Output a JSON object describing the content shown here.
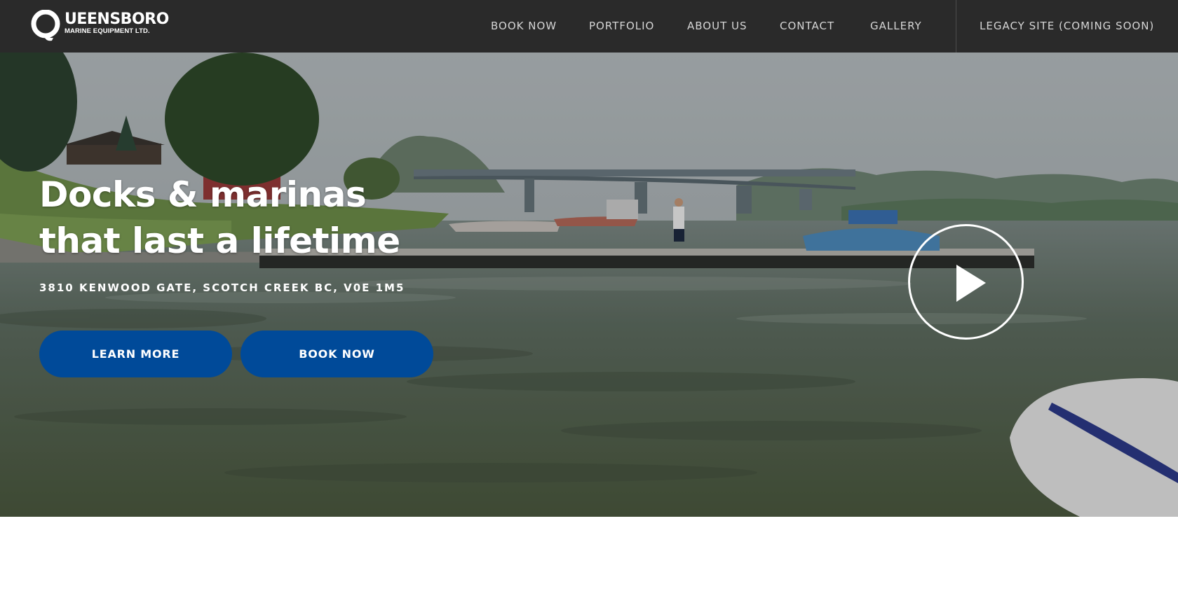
{
  "header": {
    "logo": {
      "title": "UEENSBORO",
      "subtitle": "MARINE EQUIPMENT LTD."
    },
    "nav": [
      {
        "label": "BOOK NOW"
      },
      {
        "label": "PORTFOLIO"
      },
      {
        "label": "ABOUT US"
      },
      {
        "label": "CONTACT"
      },
      {
        "label": "GALLERY"
      },
      {
        "label": "LEGACY SITE (COMING SOON)"
      }
    ]
  },
  "hero": {
    "title_line1": "Docks & marinas",
    "title_line2": "that last a lifetime",
    "address": "3810 KENWOOD GATE, SCOTCH CREEK BC, V0E 1M5",
    "buttons": {
      "learn_more": "LEARN MORE",
      "book_now": "BOOK NOW"
    },
    "play_icon": "play-icon"
  },
  "colors": {
    "header_bg": "#2a2a2a",
    "button_bg": "#004a99",
    "nav_text": "#d6d6d6"
  }
}
